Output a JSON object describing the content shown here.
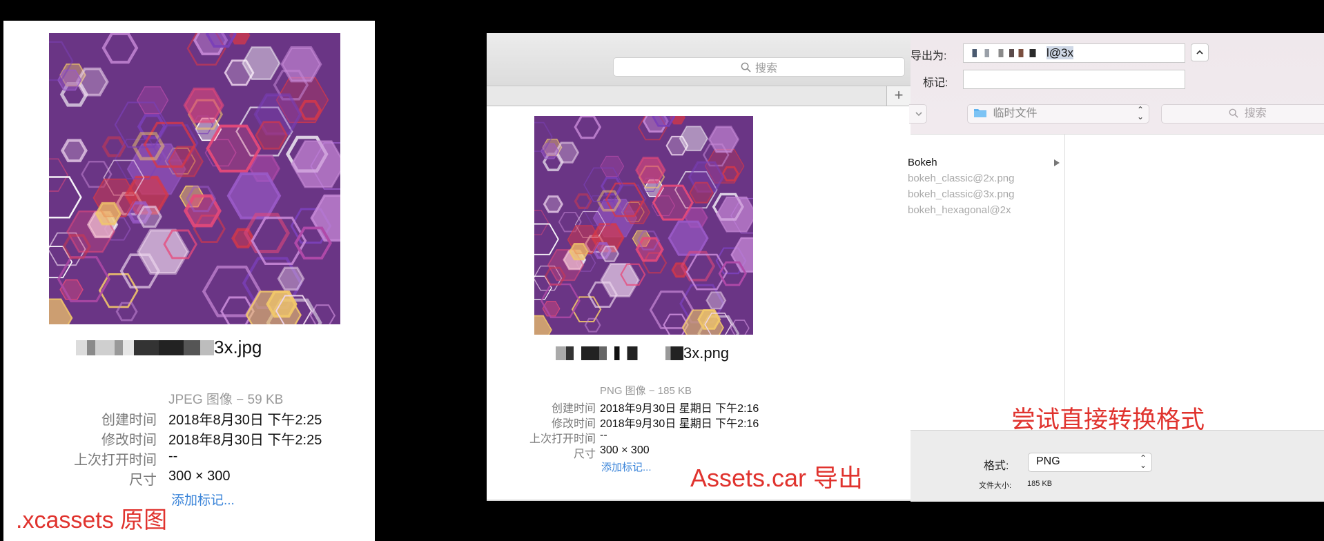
{
  "colors": {
    "accent_red": "#e0332e",
    "link_blue": "#3a84d9",
    "folder_blue": "#5fb3ef"
  },
  "panel_original": {
    "filename_visible": "3x.jpg",
    "kind": "JPEG 图像 − 59 KB",
    "rows": [
      {
        "label": "创建时间",
        "value": "2018年8月30日 下午2:25"
      },
      {
        "label": "修改时间",
        "value": "2018年8月30日 下午2:25"
      },
      {
        "label": "上次打开时间",
        "value": "--"
      },
      {
        "label": "尺寸",
        "value": "300 × 300"
      }
    ],
    "add_tags": "添加标记...",
    "annotation": ".xcassets 原图"
  },
  "panel_export": {
    "search_placeholder": "搜索",
    "plus_label": "+",
    "filename_visible": "3x.png",
    "kind": "PNG 图像 − 185 KB",
    "rows": [
      {
        "label": "创建时间",
        "value": "2018年9月30日 星期日 下午2:16"
      },
      {
        "label": "修改时间",
        "value": "2018年9月30日 星期日 下午2:16"
      },
      {
        "label": "上次打开时间",
        "value": "--"
      },
      {
        "label": "尺寸",
        "value": "300 × 300"
      }
    ],
    "add_tags": "添加标记...",
    "annotation": "Assets.car 导出"
  },
  "panel_save": {
    "export_as_label": "导出为:",
    "export_as_value": "l@3x",
    "tags_label": "标记:",
    "location": "临时文件",
    "search_placeholder": "搜索",
    "files": [
      {
        "name": "Bokeh",
        "kind": "folder"
      },
      {
        "name": "bokeh_classic@2x.png",
        "kind": "file"
      },
      {
        "name": "bokeh_classic@3x.png",
        "kind": "file"
      },
      {
        "name": "bokeh_hexagonal@2x",
        "kind": "file"
      }
    ],
    "annotation": "尝试直接转换格式",
    "format_label": "格式:",
    "format_value": "PNG",
    "filesize_label": "文件大小:",
    "filesize_value": "185 KB"
  }
}
